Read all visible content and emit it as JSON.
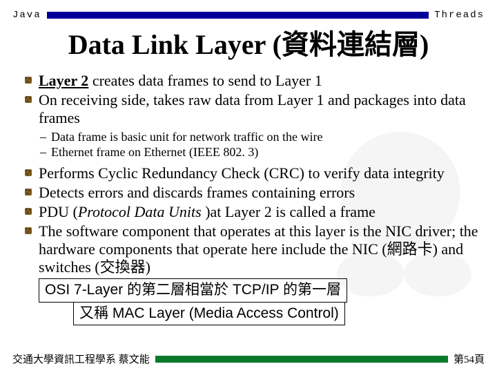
{
  "header": {
    "left": "Java",
    "right": "Threads"
  },
  "title": "Data Link Layer (資料連結層)",
  "bullets": {
    "b1_pre": "Layer 2",
    "b1_post": " creates data frames to send to Layer 1",
    "b2": "On receiving side, takes raw data from Layer 1 and packages into data frames",
    "s1": "Data frame is basic unit for network traffic on the wire",
    "s2": "Ethernet frame on Ethernet (IEEE 802. 3)",
    "b3": "Performs Cyclic Redundancy Check (CRC) to verify data integrity",
    "b4": "Detects errors and discards frames containing errors",
    "b5_a": "PDU (",
    "b5_b": "Protocol Data Units ",
    "b5_c": ")at Layer 2 is called a frame",
    "b6": "The software component that operates at this layer is the NIC driver; the hardware components that operate here include the NIC (網路卡) and switches (交換器)"
  },
  "box1": "OSI 7-Layer 的第二層相當於 TCP/IP 的第一層",
  "box2": "又稱 MAC Layer  (Media Access Control)",
  "footer": {
    "left": "交通大學資訊工程學系 蔡文能",
    "right": "第54頁"
  }
}
